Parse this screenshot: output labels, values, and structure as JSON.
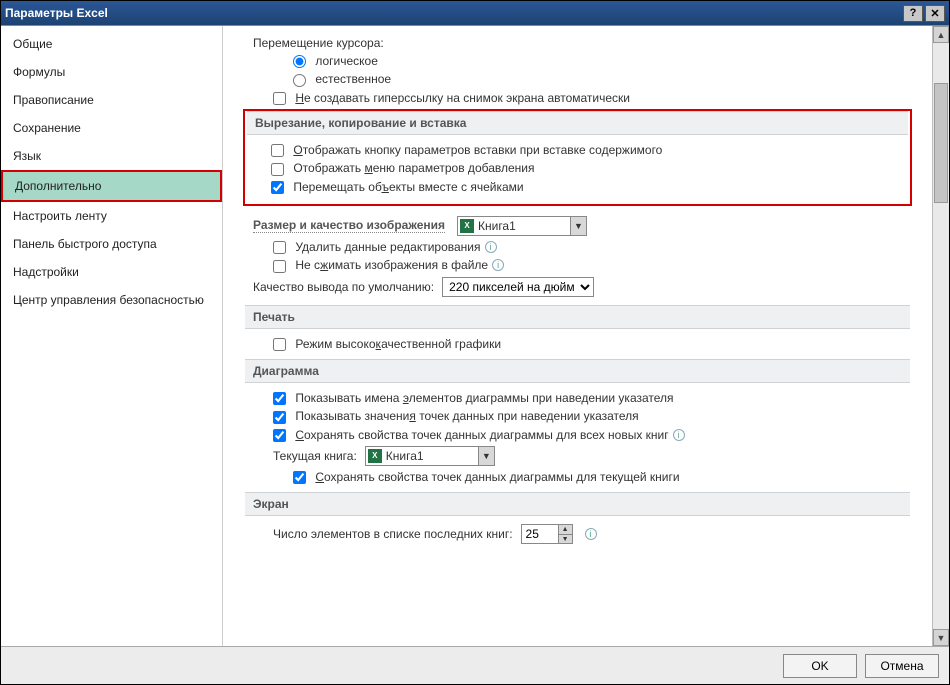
{
  "titlebar": {
    "title": "Параметры Excel"
  },
  "sidebar": {
    "items": [
      "Общие",
      "Формулы",
      "Правописание",
      "Сохранение",
      "Язык",
      "Дополнительно",
      "Настроить ленту",
      "Панель быстрого доступа",
      "Надстройки",
      "Центр управления безопасностью"
    ],
    "selected_index": 5
  },
  "cursor": {
    "label": "Перемещение курсора:",
    "opt_logical": "логическое",
    "opt_natural": "естественное"
  },
  "hyperlink_chk": "Не создавать гиперссылку на снимок экрана автоматически",
  "cutcopy": {
    "heading": "Вырезание, копирование и вставка",
    "opt1": "Отображать кнопку параметров вставки при вставке содержимого",
    "opt2": "Отображать меню параметров добавления",
    "opt3": "Перемещать объекты вместе с ячейками"
  },
  "image_quality": {
    "heading": "Размер и качество изображения",
    "book": "Книга1",
    "opt1": "Удалить данные редактирования",
    "opt2": "Не сжимать изображения в файле",
    "default_label": "Качество вывода по умолчанию:",
    "default_value": "220 пикселей на дюйм"
  },
  "print": {
    "heading": "Печать",
    "opt1": "Режим высококачественной графики"
  },
  "chart": {
    "heading": "Диаграмма",
    "opt1": "Показывать имена элементов диаграммы при наведении указателя",
    "opt2": "Показывать значения точек данных при наведении указателя",
    "opt3": "Сохранять свойства точек данных диаграммы для всех новых книг",
    "book_label": "Текущая книга:",
    "book": "Книга1",
    "opt4": "Сохранять свойства точек данных диаграммы для текущей книги"
  },
  "screen": {
    "heading": "Экран",
    "recent_label": "Число элементов в списке последних книг:",
    "recent_value": "25"
  },
  "footer": {
    "ok": "OK",
    "cancel": "Отмена"
  }
}
